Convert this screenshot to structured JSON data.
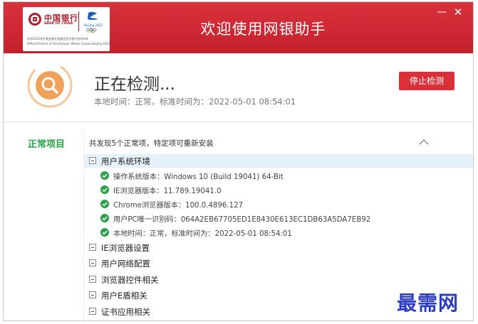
{
  "header": {
    "app_title": "欢迎使用网银助手",
    "logo": {
      "bank_cn": "中国银行",
      "bank_en": "BANK OF CHINA",
      "games_text": "Beijing 2022",
      "line1": "北京2022年冬奥会和冬残奥会官方银行合作伙伴",
      "line2": "Official Partner of the Olympic Winter Games Beijing 2022"
    },
    "minimize_glyph": "—",
    "close_glyph": "✕"
  },
  "status": {
    "title": "正在检测...",
    "subtitle": "本地时间：正常，标准时间为：2022-05-01 08:54:01",
    "stop_button": "停止检测"
  },
  "results": {
    "category_label": "正常项目",
    "summary": "共发现5个正常项，特定项可重新安装",
    "groups": [
      {
        "label": "用户系统环境",
        "items": [
          "操作系统版本：Windows 10  (Build 19041) 64-Bit",
          "IE浏览器版本：11.789.19041.0",
          "Chrome浏览器版本：100.0.4896.127",
          "用户PC唯一识别码：064A2EB67705ED1E8430E613EC1DB63A5DA7EB92",
          "本地时间：正常，标准时间为：2022-05-01 08:54:01"
        ]
      },
      {
        "label": "IE浏览器设置"
      },
      {
        "label": "用户网络配置"
      },
      {
        "label": "浏览器控件相关"
      },
      {
        "label": "用户E盾相关"
      },
      {
        "label": "证书应用相关"
      }
    ]
  },
  "watermark": "最需网",
  "colors": {
    "brand_red": "#c4202b",
    "ok_green": "#2aa14a",
    "spinner_orange": "#f0a25a"
  }
}
